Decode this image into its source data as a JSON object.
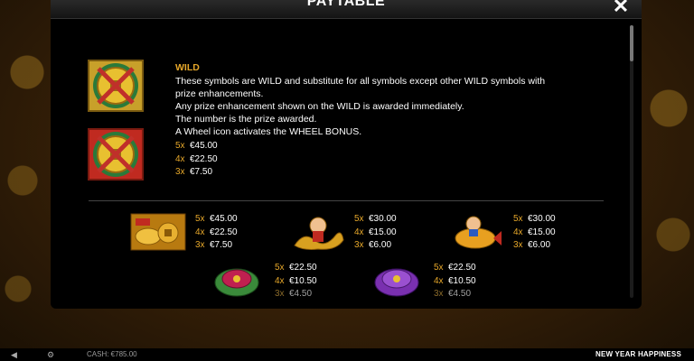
{
  "game": {
    "name": "NEW YEAR HAPPINESS",
    "cash_label": "CASH: €785.00"
  },
  "paytable": {
    "title": "PAYTABLE",
    "wild": {
      "title": "WILD",
      "lines": [
        "These symbols are WILD and substitute for all symbols except other WILD symbols with",
        "prize enhancements.",
        "Any prize enhancement shown on the WILD is awarded immediately.",
        "The number is the prize awarded.",
        "A Wheel icon activates the WHEEL BONUS."
      ],
      "pays": [
        {
          "count": "5x",
          "amount": "€45.00"
        },
        {
          "count": "4x",
          "amount": "€22.50"
        },
        {
          "count": "3x",
          "amount": "€7.50"
        }
      ]
    },
    "symbols": [
      {
        "icon": "gold-ingot-coins-icon",
        "pays": [
          {
            "count": "5x",
            "amount": "€45.00"
          },
          {
            "count": "4x",
            "amount": "€22.50"
          },
          {
            "count": "3x",
            "amount": "€7.50"
          }
        ]
      },
      {
        "icon": "boy-with-dragon-icon",
        "pays": [
          {
            "count": "5x",
            "amount": "€30.00"
          },
          {
            "count": "4x",
            "amount": "€15.00"
          },
          {
            "count": "3x",
            "amount": "€6.00"
          }
        ]
      },
      {
        "icon": "boy-with-koi-fish-icon",
        "pays": [
          {
            "count": "5x",
            "amount": "€30.00"
          },
          {
            "count": "4x",
            "amount": "€15.00"
          },
          {
            "count": "3x",
            "amount": "€6.00"
          }
        ]
      },
      {
        "icon": "red-green-pouch-icon",
        "pays": [
          {
            "count": "5x",
            "amount": "€22.50"
          },
          {
            "count": "4x",
            "amount": "€10.50"
          },
          {
            "count": "3x",
            "amount": "€4.50"
          }
        ]
      },
      {
        "icon": "purple-pouch-icon",
        "pays": [
          {
            "count": "5x",
            "amount": "€22.50"
          },
          {
            "count": "4x",
            "amount": "€10.50"
          },
          {
            "count": "3x",
            "amount": "€4.50"
          }
        ]
      }
    ]
  },
  "colors": {
    "accent_gold": "#e6a72a",
    "modal_bg": "#000000"
  }
}
